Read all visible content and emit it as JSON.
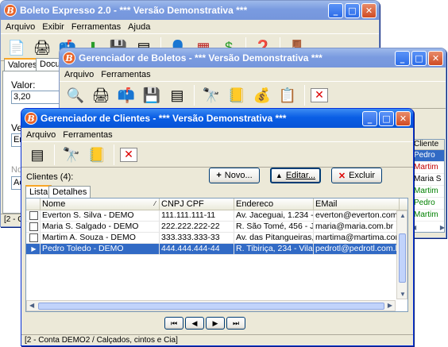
{
  "w1": {
    "title": "Boleto Expresso 2.0 - *** Versão Demonstrativa ***",
    "menu": [
      "Arquivo",
      "Exibir",
      "Ferramentas",
      "Ajuda"
    ],
    "tabs": [
      "Valores",
      "Docume"
    ],
    "valor_label": "Valor:",
    "valor_value": "3,20",
    "ve_label": "Ve",
    "en_label": "En",
    "no_label": "No",
    "ac_label": "Ac",
    "status": "[2 - C"
  },
  "w2": {
    "title": "Gerenciador de Boletos - *** Versão Demonstrativa ***",
    "menu": [
      "Arquivo",
      "Ferramentas"
    ],
    "side_header": "Cliente",
    "side_items": [
      "Pedro",
      "Martim",
      "Maria S",
      "Martim",
      "Pedro",
      "Martim"
    ],
    "side_colors": [
      "#ffffff",
      "#c00000",
      "#000000",
      "#008000",
      "#008000",
      "#008000"
    ]
  },
  "w3": {
    "title": "Gerenciador de Clientes - *** Versão Demonstrativa ***",
    "menu": [
      "Arquivo",
      "Ferramentas"
    ],
    "count_label": "Clientes (4):",
    "buttons": {
      "novo": "Novo...",
      "editar": "Editar...",
      "excluir": "Excluir"
    },
    "tabs": [
      "Lista",
      "Detalhes"
    ],
    "columns": [
      "Nome",
      "CNPJ  CPF",
      "Endereco",
      "EMail"
    ],
    "rows": [
      {
        "nome": "Everton S. Silva - DEMO",
        "cpf": "111.111.111-11",
        "end": "Av. Jaceguai, 1.234 - Vila F",
        "email": "everton@everton.com.br"
      },
      {
        "nome": "Maria S. Salgado - DEMO",
        "cpf": "222.222.222-22",
        "end": "R. São Tomé, 456 - Jardim S",
        "email": "maria@maria.com.br"
      },
      {
        "nome": "Martim A. Souza - DEMO",
        "cpf": "333.333.333-33",
        "end": "Av. das Pitangueiras, 245 -",
        "email": "martima@martima.com.br"
      },
      {
        "nome": "Pedro Toledo - DEMO",
        "cpf": "444.444.444-44",
        "end": "R. Tibiriça, 234 - Vila Almeid",
        "email": "pedrotl@pedrotl.com.br"
      }
    ],
    "nav": [
      "⏮",
      "◀",
      "▶",
      "⏭"
    ],
    "status": "[2 - Conta DEMO2 / Calçados, cintos e Cia]"
  }
}
